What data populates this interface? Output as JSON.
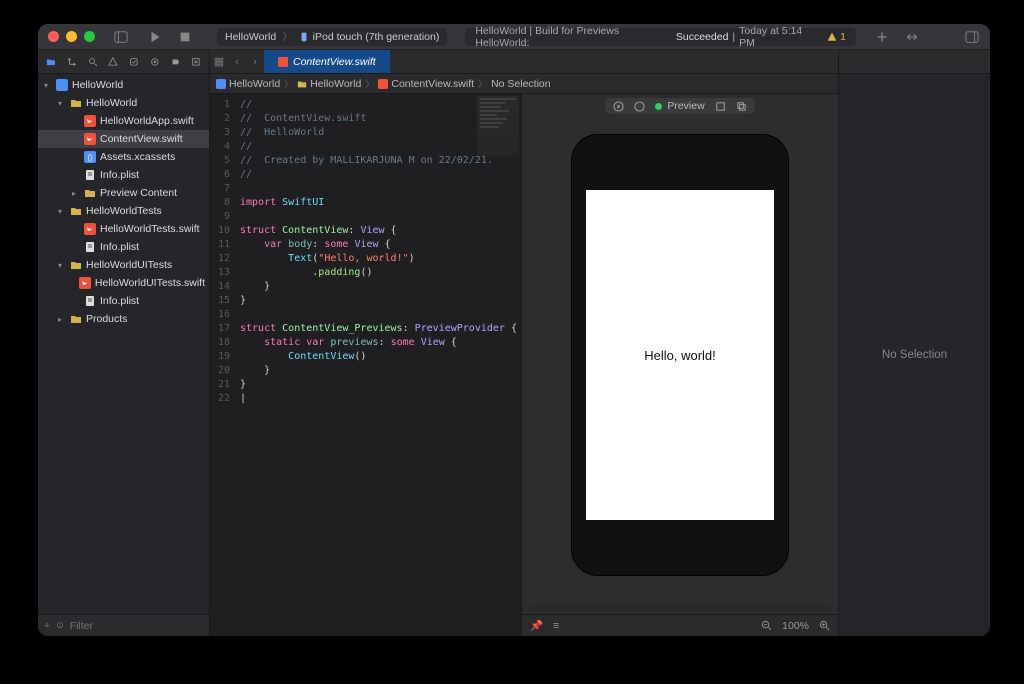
{
  "titlebar": {
    "scheme_target": "HelloWorld",
    "scheme_device": "iPod touch (7th generation)",
    "status_prefix": "HelloWorld | Build for Previews HelloWorld:",
    "status_result": "Succeeded",
    "status_time": "Today at 5:14 PM",
    "warning_count": "1"
  },
  "open_tab": {
    "filename": "ContentView.swift"
  },
  "jumpbar": {
    "c1": "HelloWorld",
    "c2": "HelloWorld",
    "c3": "ContentView.swift",
    "c4": "No Selection"
  },
  "navigator": {
    "items": [
      {
        "label": "HelloWorld",
        "icon": "folder-blue",
        "indent": 0,
        "disclosure": "down"
      },
      {
        "label": "HelloWorld",
        "icon": "folder-yellow",
        "indent": 1,
        "disclosure": "down"
      },
      {
        "label": "HelloWorldApp.swift",
        "icon": "swift",
        "indent": 2
      },
      {
        "label": "ContentView.swift",
        "icon": "swift",
        "indent": 2,
        "selected": true
      },
      {
        "label": "Assets.xcassets",
        "icon": "json",
        "indent": 2
      },
      {
        "label": "Info.plist",
        "icon": "plist",
        "indent": 2
      },
      {
        "label": "Preview Content",
        "icon": "folder-yellow",
        "indent": 2,
        "disclosure": "right"
      },
      {
        "label": "HelloWorldTests",
        "icon": "folder-yellow",
        "indent": 1,
        "disclosure": "down"
      },
      {
        "label": "HelloWorldTests.swift",
        "icon": "swift",
        "indent": 2
      },
      {
        "label": "Info.plist",
        "icon": "plist",
        "indent": 2
      },
      {
        "label": "HelloWorldUITests",
        "icon": "folder-yellow",
        "indent": 1,
        "disclosure": "down"
      },
      {
        "label": "HelloWorldUITests.swift",
        "icon": "swift",
        "indent": 2
      },
      {
        "label": "Info.plist",
        "icon": "plist",
        "indent": 2
      },
      {
        "label": "Products",
        "icon": "folder-yellow",
        "indent": 1,
        "disclosure": "right"
      }
    ],
    "filter_placeholder": "Filter"
  },
  "code": {
    "lines": [
      {
        "n": 1,
        "html": "<span class='tok-comment'>//</span>"
      },
      {
        "n": 2,
        "html": "<span class='tok-comment'>//  ContentView.swift</span>"
      },
      {
        "n": 3,
        "html": "<span class='tok-comment'>//  HelloWorld</span>"
      },
      {
        "n": 4,
        "html": "<span class='tok-comment'>//</span>"
      },
      {
        "n": 5,
        "html": "<span class='tok-comment'>//  Created by MALLIKARJUNA M on 22/02/21.</span>"
      },
      {
        "n": 6,
        "html": "<span class='tok-comment'>//</span>"
      },
      {
        "n": 7,
        "html": ""
      },
      {
        "n": 8,
        "html": "<span class='tok-keyword'>import</span> <span class='tok-type'>SwiftUI</span>"
      },
      {
        "n": 9,
        "html": ""
      },
      {
        "n": 10,
        "html": "<span class='tok-keyword'>struct</span> <span class='tok-typegreen'>ContentView</span>: <span class='tok-protocol'>View</span> {"
      },
      {
        "n": 11,
        "html": "    <span class='tok-keyword'>var</span> <span class='tok-prop'>body</span>: <span class='tok-keyword'>some</span> <span class='tok-protocol'>View</span> {"
      },
      {
        "n": 12,
        "html": "        <span class='tok-type'>Text</span>(<span class='tok-string'>\"Hello, world!\"</span>)"
      },
      {
        "n": 13,
        "html": "            .<span class='tok-func'>padding</span>()"
      },
      {
        "n": 14,
        "html": "    }"
      },
      {
        "n": 15,
        "html": "}"
      },
      {
        "n": 16,
        "html": ""
      },
      {
        "n": 17,
        "html": "<span class='tok-keyword'>struct</span> <span class='tok-typegreen'>ContentView_Previews</span>: <span class='tok-protocol'>PreviewProvider</span> {"
      },
      {
        "n": 18,
        "html": "    <span class='tok-keyword'>static</span> <span class='tok-keyword'>var</span> <span class='tok-prop'>previews</span>: <span class='tok-keyword'>some</span> <span class='tok-protocol'>View</span> {"
      },
      {
        "n": 19,
        "html": "        <span class='tok-type'>ContentView</span>()"
      },
      {
        "n": 20,
        "html": "    }"
      },
      {
        "n": 21,
        "html": "}"
      },
      {
        "n": 22,
        "html": "|"
      }
    ]
  },
  "canvas": {
    "preview_label": "Preview",
    "rendered_text": "Hello, world!",
    "zoom": "100%"
  },
  "inspector": {
    "empty_text": "No Selection"
  }
}
